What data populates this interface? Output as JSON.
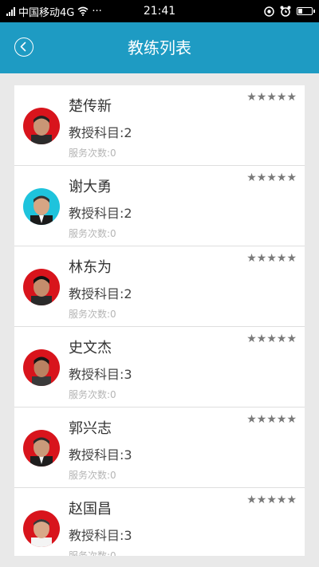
{
  "status_bar": {
    "carrier": "中国移动4G",
    "dots": "···",
    "time": "21:41"
  },
  "header": {
    "title": "教练列表",
    "back_icon": "back-arrow-circle-icon"
  },
  "colors": {
    "header_bg": "#1e9bc3",
    "avatar_red": "#d8141c",
    "avatar_cyan": "#1ec3dc"
  },
  "coaches": [
    {
      "name": "楚传新",
      "subject": "教授科目:2",
      "service": "服务次数:0",
      "rating": "★★★★★",
      "avatar_bg": "red"
    },
    {
      "name": "谢大勇",
      "subject": "教授科目:2",
      "service": "服务次数:0",
      "rating": "★★★★★",
      "avatar_bg": "cyan"
    },
    {
      "name": "林东为",
      "subject": "教授科目:2",
      "service": "服务次数:0",
      "rating": "★★★★★",
      "avatar_bg": "red"
    },
    {
      "name": "史文杰",
      "subject": "教授科目:3",
      "service": "服务次数:0",
      "rating": "★★★★★",
      "avatar_bg": "red"
    },
    {
      "name": "郭兴志",
      "subject": "教授科目:3",
      "service": "服务次数:0",
      "rating": "★★★★★",
      "avatar_bg": "red"
    },
    {
      "name": "赵国昌",
      "subject": "教授科目:3",
      "service": "服务次数:0",
      "rating": "★★★★★",
      "avatar_bg": "red"
    }
  ]
}
